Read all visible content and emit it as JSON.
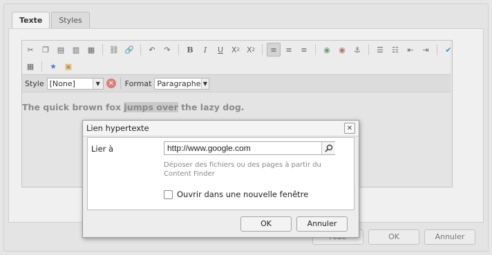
{
  "tabs": [
    {
      "label": "Texte",
      "active": true
    },
    {
      "label": "Styles",
      "active": false
    }
  ],
  "toolbar": {
    "row1_icons": [
      "cut-icon",
      "copy-icon",
      "paste-icon",
      "paste-text-icon",
      "paste-word-icon",
      "unlink-icon",
      "link-icon",
      "undo-icon",
      "redo-icon",
      "bold-icon",
      "italic-icon",
      "underline-icon",
      "subscript-icon",
      "superscript-icon",
      "align-left-icon",
      "align-center-icon",
      "align-right-icon",
      "find-icon",
      "replace-icon",
      "anchor-icon",
      "bulleted-list-icon",
      "numbered-list-icon",
      "outdent-icon",
      "indent-icon",
      "spellcheck-icon"
    ],
    "row2_icons": [
      "table-icon",
      "special-char-icon",
      "image-icon"
    ]
  },
  "stylebar": {
    "style_label": "Style",
    "style_value": "[None]",
    "format_label": "Format",
    "format_value": "Paragraphe"
  },
  "editor": {
    "text_before": "The quick brown fox ",
    "text_selected": "jumps over",
    "text_after": " the lazy dog."
  },
  "bottom_buttons": {
    "help": "Aide",
    "ok": "OK",
    "cancel": "Annuler"
  },
  "dialog": {
    "title": "Lien hypertexte",
    "link_label": "Lier à",
    "url_value": "http://www.google.com",
    "hint": "Déposer des fichiers ou des pages à partir du Content Finder",
    "new_window_label": "Ouvrir dans une nouvelle fenêtre",
    "new_window_checked": false,
    "ok": "OK",
    "cancel": "Annuler"
  }
}
